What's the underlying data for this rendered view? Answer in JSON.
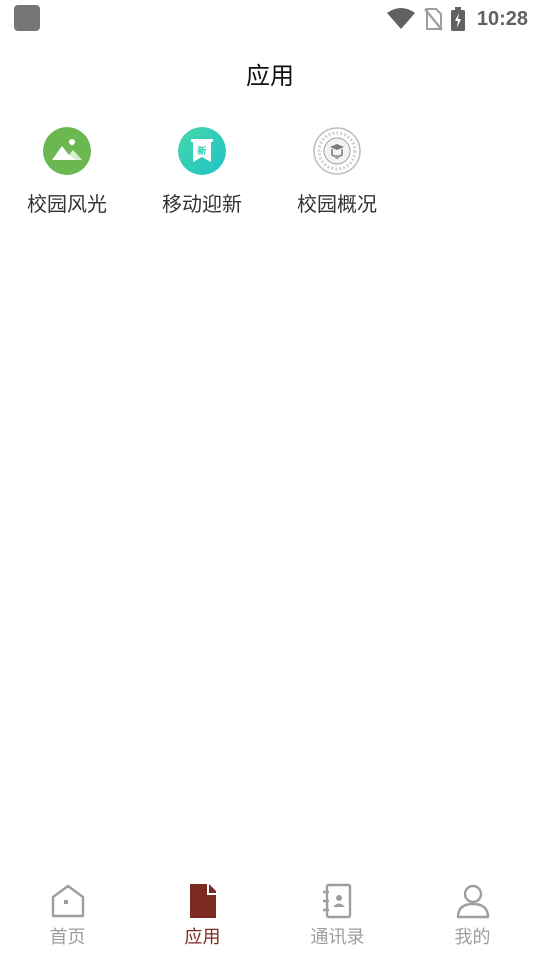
{
  "status_bar": {
    "time": "10:28",
    "icons": [
      "app-notification-icon",
      "wifi-icon",
      "no-sim-icon",
      "battery-charging-icon"
    ]
  },
  "header": {
    "title": "应用"
  },
  "apps": [
    {
      "label": "校园风光",
      "icon": "landscape-icon",
      "color": "#6ab84f"
    },
    {
      "label": "移动迎新",
      "icon": "new-student-icon",
      "color": "#2fcfb5"
    },
    {
      "label": "校园概况",
      "icon": "university-seal-icon",
      "color": "#9e9e9e"
    }
  ],
  "bottom_nav": {
    "active_index": 1,
    "active_color": "#7b2a20",
    "inactive_color": "#9e9e9e",
    "items": [
      {
        "label": "首页",
        "icon": "home-icon"
      },
      {
        "label": "应用",
        "icon": "document-icon"
      },
      {
        "label": "通讯录",
        "icon": "contacts-book-icon"
      },
      {
        "label": "我的",
        "icon": "profile-icon"
      }
    ]
  }
}
